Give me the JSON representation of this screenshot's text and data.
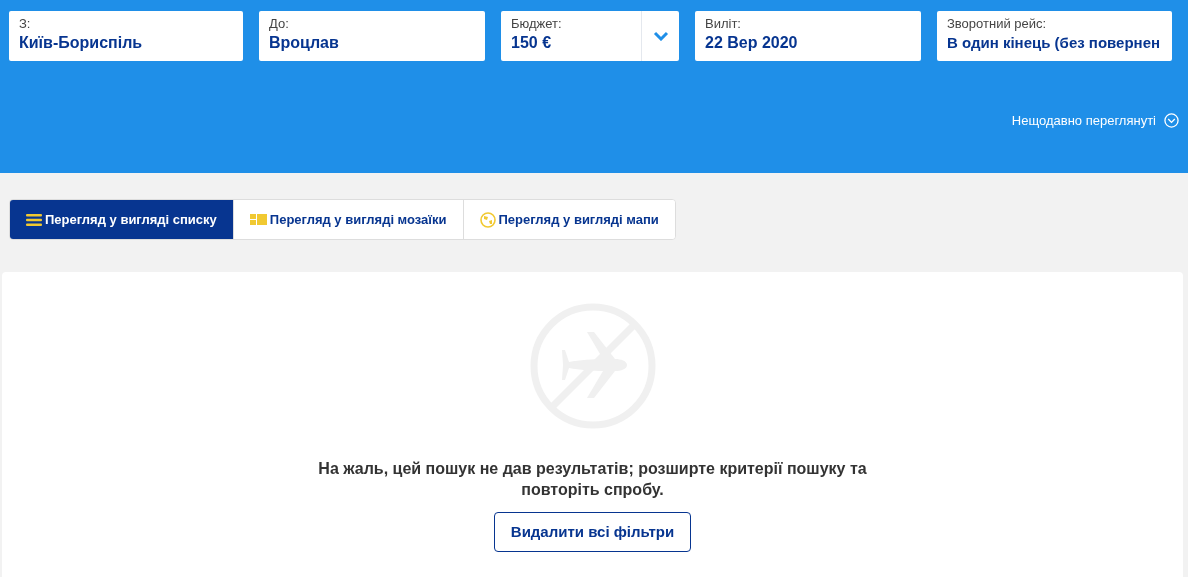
{
  "search_fields": [
    {
      "label": "З:",
      "value": "Київ-Бориспіль",
      "kind": "text"
    },
    {
      "label": "До:",
      "value": "Вроцлав",
      "kind": "text"
    },
    {
      "label": "Бюджет:",
      "value": "150 €",
      "kind": "select"
    },
    {
      "label": "Виліт:",
      "value": "22 Вер 2020",
      "kind": "text"
    },
    {
      "label": "Зворотний рейс:",
      "value": "В один кінець (без повернен",
      "kind": "text"
    }
  ],
  "recently_viewed": {
    "label": "Нещодавно переглянуті",
    "expanded": false
  },
  "view_tabs": [
    {
      "label": "Перегляд у вигляді списку",
      "kind": "list",
      "selected": true
    },
    {
      "label": "Перегляд у вигляді мозаїки",
      "kind": "mosaic",
      "selected": false
    },
    {
      "label": "Перегляд у вигляді мапи",
      "kind": "map",
      "selected": false
    }
  ],
  "empty_state": {
    "message": "На жаль, цей пошук не дав результатів; розширте критерії пошуку та повторіть спробу.",
    "button": "Видалити всі фільтри"
  }
}
